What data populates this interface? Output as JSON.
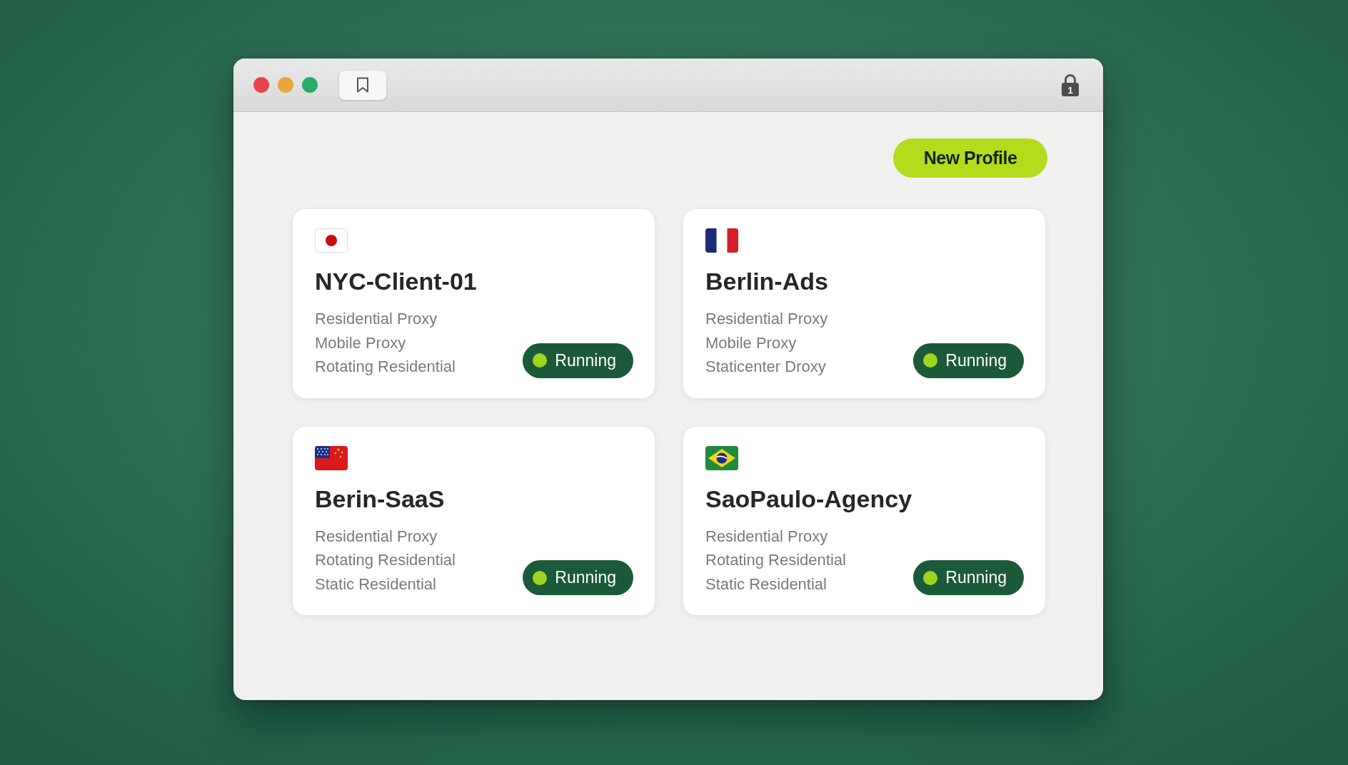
{
  "title_bar": {
    "lock_count": "1"
  },
  "new_profile_button": {
    "label": "New Profile"
  },
  "profiles": [
    {
      "name": "NYC-Client-01",
      "proxies": [
        "Residential Proxy",
        "Mobile Proxy",
        "Rotating Residential"
      ],
      "status": "Running"
    },
    {
      "name": "Berlin-Ads",
      "proxies": [
        "Residential Proxy",
        "Mobile Proxy",
        "Staticenter Droxy"
      ],
      "status": "Running"
    },
    {
      "name": "Berin-SaaS",
      "proxies": [
        "Residential Proxy",
        "Rotating Residential",
        "Static Residential"
      ],
      "status": "Running"
    },
    {
      "name": "SaoPaulo-Agency",
      "proxies": [
        "Residential Proxy",
        "Rotating Residential",
        "Static Residential"
      ],
      "status": "Running"
    }
  ]
}
